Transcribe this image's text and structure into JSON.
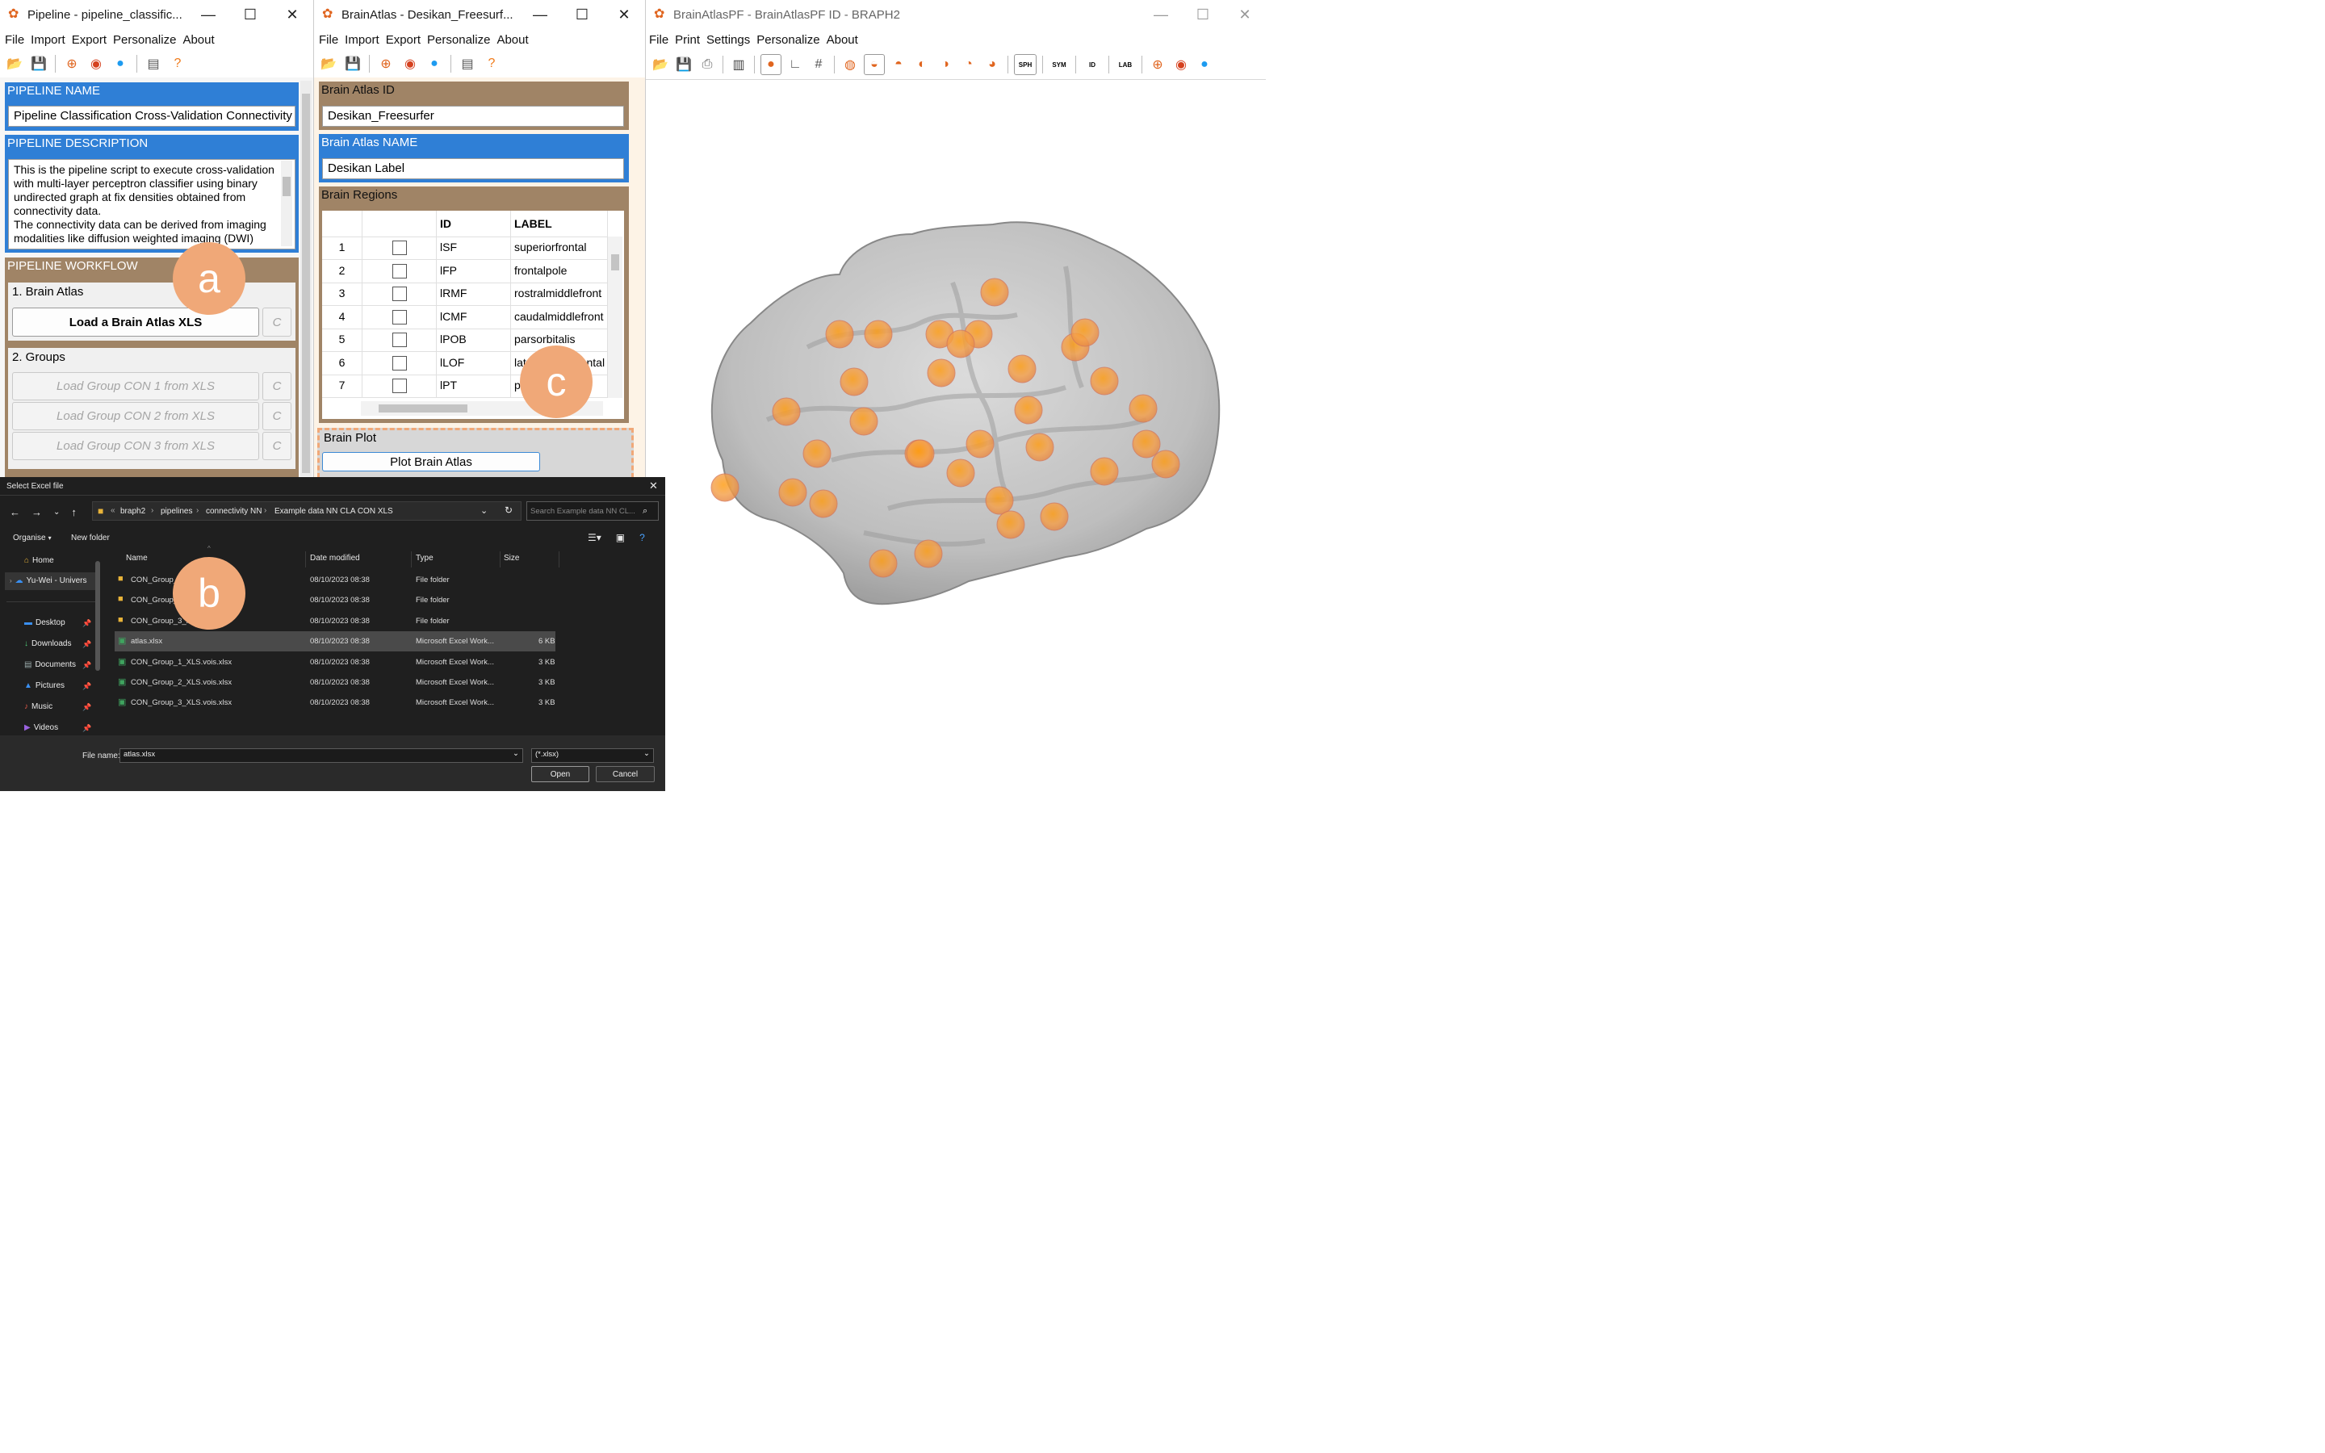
{
  "pipeline_window": {
    "title": "Pipeline - pipeline_classific...",
    "menu": [
      "File",
      "Import",
      "Export",
      "Personalize",
      "About"
    ],
    "name_label": "PIPELINE NAME",
    "name_value": "Pipeline Classification Cross-Validation Connectivity E",
    "description_label": "PIPELINE DESCRIPTION",
    "description_text": "This is the pipeline script to execute cross-validation with multi-layer perceptron classifier using binary undirected graph at fix densities obtained from connectivity data.\nThe connectivity data can be derived from imaging modalities like diffusion weighted imaging (DWI)",
    "workflow_label": "PIPELINE WORKFLOW",
    "step1_label": "1. Brain Atlas",
    "step1_button": "Load a Brain Atlas XLS",
    "step2_label": "2. Groups",
    "group_buttons": [
      "Load Group CON 1 from XLS",
      "Load Group CON 2 from XLS",
      "Load Group CON 3 from XLS"
    ],
    "c_button": "C"
  },
  "atlas_window": {
    "title": "BrainAtlas - Desikan_Freesurf...",
    "menu": [
      "File",
      "Import",
      "Export",
      "Personalize",
      "About"
    ],
    "id_label": "Brain Atlas ID",
    "id_value": "Desikan_Freesurfer",
    "name_label": "Brain Atlas NAME",
    "name_value": "Desikan Label",
    "regions_label": "Brain Regions",
    "columns": [
      "",
      "",
      "ID",
      "LABEL"
    ],
    "rows": [
      {
        "n": "1",
        "id": "lSF",
        "label": "superiorfrontal"
      },
      {
        "n": "2",
        "id": "lFP",
        "label": "frontalpole"
      },
      {
        "n": "3",
        "id": "lRMF",
        "label": "rostralmiddlefront"
      },
      {
        "n": "4",
        "id": "lCMF",
        "label": "caudalmiddlefront"
      },
      {
        "n": "5",
        "id": "lPOB",
        "label": "parsorbitalis"
      },
      {
        "n": "6",
        "id": "lLOF",
        "label": "lateralorbitofrontal"
      },
      {
        "n": "7",
        "id": "lPT",
        "label": "parstriangularis"
      }
    ],
    "plot_label": "Brain Plot",
    "plot_button": "Plot Brain Atlas"
  },
  "brainplot_window": {
    "title": "BrainAtlasPF - BrainAtlasPF ID - BRAPH2",
    "menu": [
      "File",
      "Print",
      "Settings",
      "Personalize",
      "About"
    ],
    "toolbar_text": [
      "SPH",
      "SYM",
      "ID",
      "LAB"
    ]
  },
  "dialog": {
    "title": "Select Excel file",
    "breadcrumb": [
      "braph2",
      "pipelines",
      "connectivity NN",
      "Example data NN CLA CON XLS"
    ],
    "search_placeholder": "Search Example data NN CL...",
    "organise": "Organise",
    "new_folder": "New folder",
    "sidebar": [
      {
        "label": "Home",
        "icon": "home-icon"
      },
      {
        "label": "Yu-Wei - Univers",
        "icon": "cloud-icon"
      },
      {
        "label": "Desktop",
        "icon": "desktop-icon"
      },
      {
        "label": "Downloads",
        "icon": "download-icon"
      },
      {
        "label": "Documents",
        "icon": "documents-icon"
      },
      {
        "label": "Pictures",
        "icon": "pictures-icon"
      },
      {
        "label": "Music",
        "icon": "music-icon"
      },
      {
        "label": "Videos",
        "icon": "videos-icon"
      }
    ],
    "columns": [
      "Name",
      "Date modified",
      "Type",
      "Size"
    ],
    "files": [
      {
        "name": "CON_Group_",
        "date": "08/10/2023 08:38",
        "type": "File folder",
        "size": ""
      },
      {
        "name": "CON_Group_",
        "date": "08/10/2023 08:38",
        "type": "File folder",
        "size": ""
      },
      {
        "name": "CON_Group_3_X",
        "date": "08/10/2023 08:38",
        "type": "File folder",
        "size": ""
      },
      {
        "name": "atlas.xlsx",
        "date": "08/10/2023 08:38",
        "type": "Microsoft Excel Work...",
        "size": "6 KB"
      },
      {
        "name": "CON_Group_1_XLS.vois.xlsx",
        "date": "08/10/2023 08:38",
        "type": "Microsoft Excel Work...",
        "size": "3 KB"
      },
      {
        "name": "CON_Group_2_XLS.vois.xlsx",
        "date": "08/10/2023 08:38",
        "type": "Microsoft Excel Work...",
        "size": "3 KB"
      },
      {
        "name": "CON_Group_3_XLS.vois.xlsx",
        "date": "08/10/2023 08:38",
        "type": "Microsoft Excel Work...",
        "size": "3 KB"
      }
    ],
    "filename_label": "File name:",
    "filename_value": "atlas.xlsx",
    "filetype_value": "(*.xlsx)",
    "open_button": "Open",
    "cancel_button": "Cancel"
  },
  "callouts": {
    "a": "a",
    "b": "b",
    "c": "c"
  },
  "colors": {
    "blue_panel": "#2f7fd6",
    "brown_panel": "#a08466",
    "callout": "#f0a878",
    "node": "#f59a2a"
  }
}
